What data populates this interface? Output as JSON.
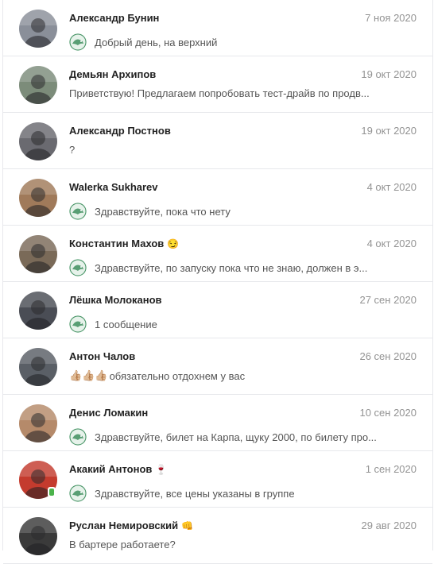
{
  "dialogs": [
    {
      "name": "Александр Бунин",
      "emoji": "",
      "date": "7 ноя 2020",
      "message": "Добрый день, на верхний",
      "has_mini_avatar": true,
      "online": false
    },
    {
      "name": "Демьян Архипов",
      "emoji": "",
      "date": "19 окт 2020",
      "message": "Приветствую! Предлагаем попробовать тест-драйв по продв...",
      "has_mini_avatar": false,
      "online": false
    },
    {
      "name": "Александр Постнов",
      "emoji": "",
      "date": "19 окт 2020",
      "message": "?",
      "has_mini_avatar": false,
      "online": false
    },
    {
      "name": "Walerka Sukharev",
      "emoji": "",
      "date": "4 окт 2020",
      "message": "Здравствуйте, пока что нету",
      "has_mini_avatar": true,
      "online": false
    },
    {
      "name": "Константин Махов",
      "emoji": "😏",
      "date": "4 окт 2020",
      "message": "Здравствуйте, по запуску пока что не знаю, должен в э...",
      "has_mini_avatar": true,
      "online": false
    },
    {
      "name": "Лёшка Молоканов",
      "emoji": "",
      "date": "27 сен 2020",
      "message": "1 сообщение",
      "has_mini_avatar": true,
      "online": false
    },
    {
      "name": "Антон Чалов",
      "emoji": "",
      "date": "26 сен 2020",
      "message": "обязательно отдохнем у вас",
      "prefix_emoji": "👍🏼👍🏼👍🏼",
      "has_mini_avatar": false,
      "online": false
    },
    {
      "name": "Денис Ломакин",
      "emoji": "",
      "date": "10 сен 2020",
      "message": "Здравствуйте, билет на Карпа, щуку 2000, по билету про...",
      "has_mini_avatar": true,
      "online": false
    },
    {
      "name": "Акакий Антонов",
      "emoji": "🍷",
      "date": "1 сен 2020",
      "message": "Здравствуйте, все цены указаны в группе",
      "has_mini_avatar": true,
      "online": true
    },
    {
      "name": "Руслан Немировский",
      "emoji": "👊",
      "date": "29 авг 2020",
      "message": "В бартере работаете?",
      "has_mini_avatar": false,
      "online": false
    }
  ],
  "avatar_colors": [
    "#8a8f99",
    "#7c8c7a",
    "#6a6a70",
    "#a07a5a",
    "#7a6a58",
    "#4a4d55",
    "#5a5f66",
    "#b58a6a",
    "#c43b2e",
    "#3a3a3a"
  ],
  "mini_avatar_color": "#e6f2ea",
  "mini_avatar_accent": "#3f8f5f"
}
